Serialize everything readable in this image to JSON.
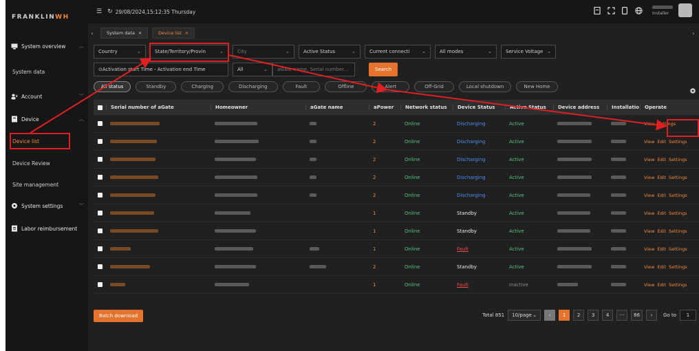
{
  "brand": {
    "name_a": "FRANKLIN",
    "name_b": "WH"
  },
  "sidebar": {
    "items": [
      {
        "label": "System overview",
        "icon": "monitor-icon"
      },
      {
        "label": "System data"
      },
      {
        "label": "Account",
        "icon": "users-icon"
      },
      {
        "label": "Device",
        "icon": "device-icon"
      },
      {
        "label": "Device list"
      },
      {
        "label": "Device Review"
      },
      {
        "label": "Site management"
      },
      {
        "label": "System settings",
        "icon": "gear-icon"
      },
      {
        "label": "Labor reimbursement",
        "icon": "document-icon"
      }
    ]
  },
  "topbar": {
    "datetime": "29/08/2024,15:12:35 Thursday",
    "role": "Installer"
  },
  "tabs": [
    {
      "label": "System data"
    },
    {
      "label": "Device list"
    }
  ],
  "filters": {
    "country": "Country",
    "state": "State/Territory/Provin",
    "city": "City",
    "active_status": "Active Status",
    "current_connection": "Current connecti",
    "modes": "All modes",
    "service_voltage": "Service Voltage",
    "date_range": "⊙Activation start Time  -  Activation end Time",
    "all": "All",
    "search_placeholder": "aGate name, Serial number...",
    "search_button": "Search"
  },
  "status_chips": [
    "All status",
    "Standby",
    "Charging",
    "Discharging",
    "Fault",
    "Offline",
    "Alert",
    "Off-Grid",
    "Local shutdown",
    "New Home"
  ],
  "table": {
    "headers": [
      "Serial number of aGate",
      "Homeowner",
      "aGate name",
      "aPower",
      "Network status",
      "Device Status",
      "Active Status",
      "Device address",
      "Installatio",
      "Operate"
    ],
    "rows": [
      {
        "apower": "2",
        "network": "Online",
        "device": "Discharging",
        "active": "Active",
        "ops": [
          "View",
          "Settings"
        ]
      },
      {
        "apower": "2",
        "network": "Online",
        "device": "Discharging",
        "active": "Active",
        "ops": [
          "View",
          "Edit",
          "Settings"
        ]
      },
      {
        "apower": "2",
        "network": "Online",
        "device": "Discharging",
        "active": "Active",
        "ops": [
          "View",
          "Edit",
          "Settings"
        ]
      },
      {
        "apower": "2",
        "network": "Online",
        "device": "Discharging",
        "active": "Active",
        "ops": [
          "View",
          "Edit",
          "Settings"
        ]
      },
      {
        "apower": "2",
        "network": "Online",
        "device": "Discharging",
        "active": "Active",
        "ops": [
          "View",
          "Edit",
          "Settings"
        ]
      },
      {
        "apower": "1",
        "network": "Online",
        "device": "Standby",
        "active": "Active",
        "ops": [
          "View",
          "Edit",
          "Settings"
        ]
      },
      {
        "apower": "1",
        "network": "Online",
        "device": "Standby",
        "active": "Active",
        "ops": [
          "View",
          "Edit",
          "Settings"
        ]
      },
      {
        "apower": "1",
        "network": "Online",
        "device": "Fault",
        "active": "Active",
        "ops": [
          "View",
          "Edit",
          "Settings"
        ]
      },
      {
        "apower": "2",
        "network": "Online",
        "device": "Standby",
        "active": "Active",
        "ops": [
          "View",
          "Edit",
          "Settings"
        ]
      },
      {
        "apower": "1",
        "network": "Online",
        "device": "Fault",
        "active": "Inactive",
        "ops": [
          "View",
          "Edit",
          "Settings"
        ]
      }
    ]
  },
  "footer": {
    "batch_download": "Batch download",
    "total": "Total 851",
    "page_size": "10/page",
    "pages": [
      "1",
      "2",
      "3",
      "4",
      "···",
      "86"
    ],
    "prev": "‹",
    "next": "›",
    "goto_label": "Go to",
    "goto_value": "1"
  },
  "colors": {
    "accent": "#f28a3c",
    "annotation": "#e02020",
    "online": "#55c27a",
    "discharging": "#4a8ef0",
    "fault": "#f04848"
  }
}
